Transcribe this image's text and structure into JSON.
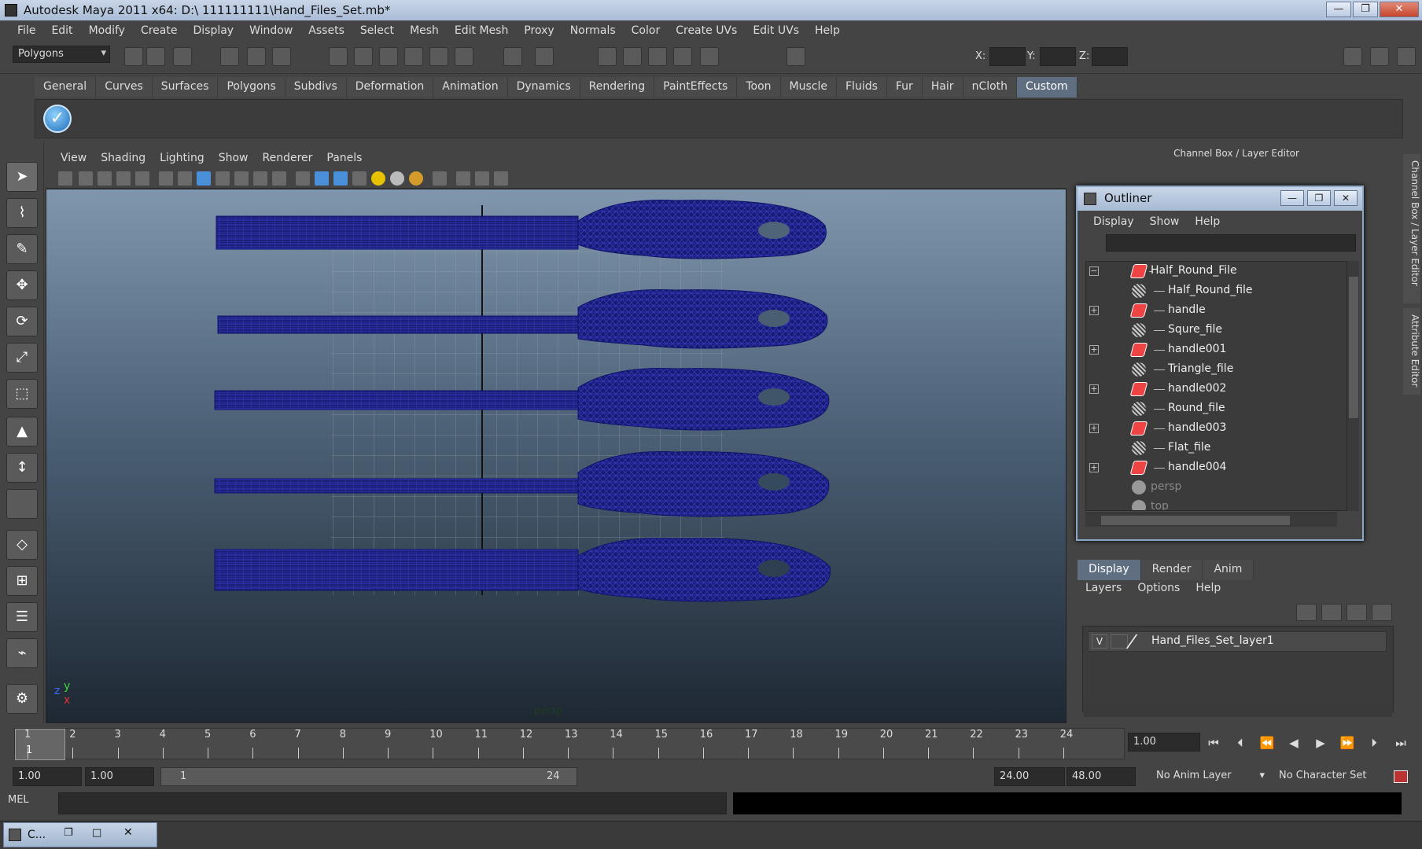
{
  "window": {
    "title": "Autodesk Maya 2011 x64: D:\\ 111111111\\Hand_Files_Set.mb*",
    "min": "—",
    "max": "❐",
    "close": "✕"
  },
  "menubar": [
    "File",
    "Edit",
    "Modify",
    "Create",
    "Display",
    "Window",
    "Assets",
    "Select",
    "Mesh",
    "Edit Mesh",
    "Proxy",
    "Normals",
    "Color",
    "Create UVs",
    "Edit UVs",
    "Help"
  ],
  "status": {
    "mode": "Polygons",
    "x_label": "X:",
    "y_label": "Y:",
    "z_label": "Z:"
  },
  "shelf": {
    "tabs": [
      "General",
      "Curves",
      "Surfaces",
      "Polygons",
      "Subdivs",
      "Deformation",
      "Animation",
      "Dynamics",
      "Rendering",
      "PaintEffects",
      "Toon",
      "Muscle",
      "Fluids",
      "Fur",
      "Hair",
      "nCloth",
      "Custom"
    ],
    "active": "Custom"
  },
  "viewport": {
    "menu": [
      "View",
      "Shading",
      "Lighting",
      "Show",
      "Renderer",
      "Panels"
    ],
    "camera_label": "persp",
    "axis": {
      "z": "z",
      "y": "y",
      "x": "x"
    }
  },
  "right": {
    "header": "Channel Box / Layer Editor",
    "side_tab_1": "Channel Box / Layer Editor",
    "side_tab_2": "Attribute Editor"
  },
  "outliner": {
    "title": "Outliner",
    "menu": [
      "Display",
      "Show",
      "Help"
    ],
    "items": [
      {
        "label": "Half_Round_File",
        "icon": "transform-icon",
        "expand": "−",
        "depth": 0
      },
      {
        "label": "Half_Round_file",
        "icon": "mesh-icon",
        "expand": "",
        "depth": 1
      },
      {
        "label": "handle",
        "icon": "transform-icon",
        "expand": "+",
        "depth": 1
      },
      {
        "label": "Squre_file",
        "icon": "mesh-icon",
        "expand": "",
        "depth": 1
      },
      {
        "label": "handle001",
        "icon": "transform-icon",
        "expand": "+",
        "depth": 1
      },
      {
        "label": "Triangle_file",
        "icon": "mesh-icon",
        "expand": "",
        "depth": 1
      },
      {
        "label": "handle002",
        "icon": "transform-icon",
        "expand": "+",
        "depth": 1
      },
      {
        "label": "Round_file",
        "icon": "mesh-icon",
        "expand": "",
        "depth": 1
      },
      {
        "label": "handle003",
        "icon": "transform-icon",
        "expand": "+",
        "depth": 1
      },
      {
        "label": "Flat_file",
        "icon": "mesh-icon",
        "expand": "",
        "depth": 1
      },
      {
        "label": "handle004",
        "icon": "transform-icon",
        "expand": "+",
        "depth": 1
      },
      {
        "label": "persp",
        "icon": "camera-icon",
        "expand": "",
        "depth": 0,
        "dim": true
      },
      {
        "label": "top",
        "icon": "camera-icon",
        "expand": "",
        "depth": 0,
        "dim": true
      }
    ]
  },
  "layers": {
    "tabs": [
      "Display",
      "Render",
      "Anim"
    ],
    "active_tab": "Display",
    "menu": [
      "Layers",
      "Options",
      "Help"
    ],
    "rows": [
      {
        "visible": "V",
        "name": "Hand_Files_Set_layer1"
      }
    ]
  },
  "timeline": {
    "frames": [
      "1",
      "2",
      "3",
      "4",
      "5",
      "6",
      "7",
      "8",
      "9",
      "10",
      "11",
      "12",
      "13",
      "14",
      "15",
      "16",
      "17",
      "18",
      "19",
      "20",
      "21",
      "22",
      "23",
      "24"
    ],
    "current_frame": "1",
    "current_time": "1.00"
  },
  "range": {
    "start_time": "1.00",
    "playback_start": "1.00",
    "range_start": "1",
    "range_end": "24",
    "playback_end": "24.00",
    "end_time": "48.00",
    "anim_layer": "No Anim Layer",
    "character_set": "No Character Set"
  },
  "command": {
    "label": "MEL"
  },
  "taskbar": {
    "label": "C..."
  },
  "colors": {
    "wireframe": "#1a1a8c",
    "viewport_top": "#7f96ad",
    "viewport_bottom": "#1e2833",
    "active_tab": "#5f6e80"
  }
}
